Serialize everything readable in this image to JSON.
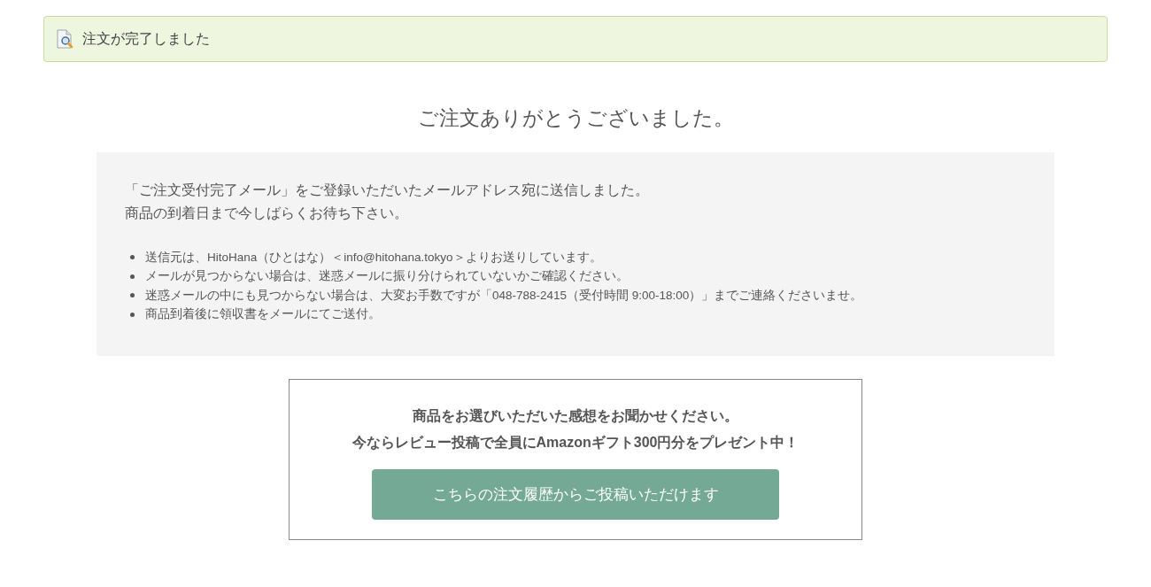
{
  "alert": {
    "text": "注文が完了しました"
  },
  "heading": "ご注文ありがとうございました。",
  "notice": {
    "lines": [
      "「ご注文受付完了メール」をご登録いただいたメールアドレス宛に送信しました。",
      "商品の到着日まで今しばらくお待ち下さい。"
    ],
    "bullets": [
      "送信元は、HitoHana（ひとはな）＜info@hitohana.tokyo＞よりお送りしています。",
      "メールが見つからない場合は、迷惑メールに振り分けられていないかご確認ください。",
      "迷惑メールの中にも見つからない場合は、大変お手数ですが「048-788-2415（受付時間 9:00-18:00）」までご連絡くださいませ。",
      "商品到着後に領収書をメールにてご送付。"
    ]
  },
  "review": {
    "lines": [
      "商品をお選びいただいた感想をお聞かせください。",
      "今ならレビュー投稿で全員にAmazonギフト300円分をプレゼント中！"
    ],
    "button": "こちらの注文履歴からご投稿いただけます"
  }
}
